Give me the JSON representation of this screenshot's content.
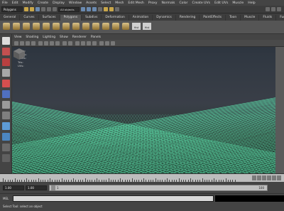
{
  "menubar": {
    "items": [
      "File",
      "Edit",
      "Modify",
      "Create",
      "Display",
      "Window",
      "Assets",
      "Select",
      "Mesh",
      "Edit Mesh",
      "Proxy",
      "Normals",
      "Color",
      "Create UVs",
      "Edit UVs",
      "Muscle",
      "Help"
    ]
  },
  "statusline": {
    "mode": "Polygons",
    "object_filter": "All objects"
  },
  "shelf": {
    "tabs": [
      "General",
      "Curves",
      "Surfaces",
      "Polygons",
      "Subdivs",
      "Deformation",
      "Animation",
      "Dynamics",
      "Rendering",
      "PaintEffects",
      "Toon",
      "Muscle",
      "Fluids",
      "Fur"
    ],
    "active_tab": "Polygons",
    "hist_labels": [
      "Hist",
      "Hist"
    ]
  },
  "panel": {
    "menus": [
      "View",
      "Shading",
      "Lighting",
      "Show",
      "Renderer",
      "Panels"
    ]
  },
  "hud": {
    "rows": [
      "Verts:",
      "Edges:",
      "Faces:",
      "Tris:",
      "UVs:"
    ]
  },
  "timeline": {
    "range_start": "1.00",
    "range_start_inner": "1.00",
    "range_track_start": "1",
    "range_track_end": "100"
  },
  "command": {
    "label": "MEL"
  },
  "helpline": {
    "text": "Select Tool: select an object"
  },
  "colors": {
    "mesh_wire": "#5fe6b0",
    "viewport_top": "#2e3640",
    "viewport_bottom": "#1f3a2e"
  }
}
